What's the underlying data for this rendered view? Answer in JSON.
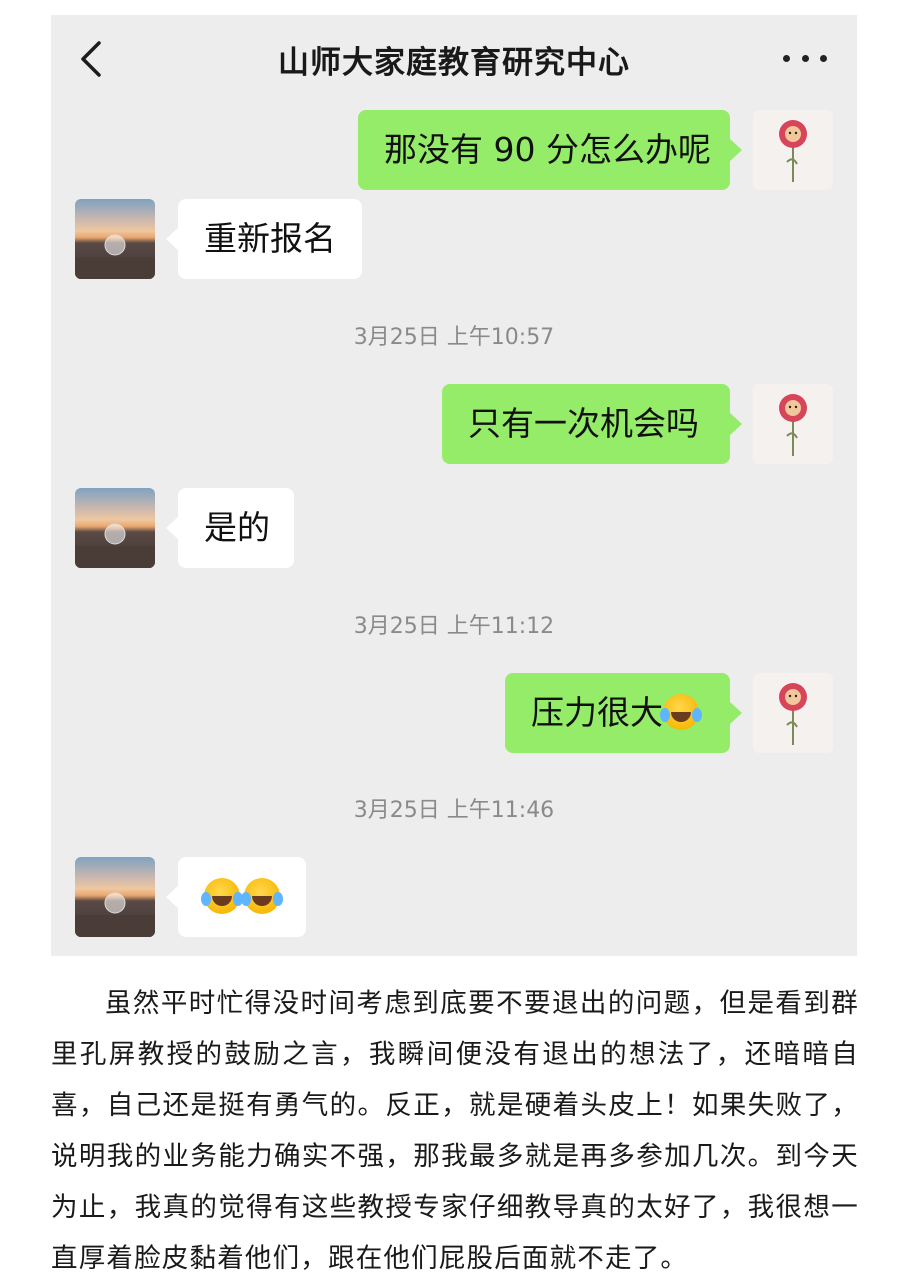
{
  "chat": {
    "title": "山师大家庭教育研究中心",
    "back_icon": "chevron-left-icon",
    "more_icon": "more-dots-icon",
    "messages": [
      {
        "side": "sent",
        "text": "那没有 90 分怎么办呢"
      },
      {
        "side": "recv",
        "text": "重新报名"
      },
      {
        "type": "time",
        "text": "3月25日 上午10:57"
      },
      {
        "side": "sent",
        "text": "只有一次机会吗"
      },
      {
        "side": "recv",
        "text": "是的"
      },
      {
        "type": "time",
        "text": "3月25日 上午11:12"
      },
      {
        "side": "sent",
        "text": "压力很大",
        "emoji": "tears-of-joy-emoji"
      },
      {
        "type": "time",
        "text": "3月25日 上午11:46"
      },
      {
        "side": "recv",
        "text": "",
        "emoji": "rolling-laughing-emoji x2"
      }
    ]
  },
  "article": {
    "paragraph": "虽然平时忙得没时间考虑到底要不要退出的问题，但是看到群里孔屏教授的鼓励之言，我瞬间便没有退出的想法了，还暗暗自喜，自己还是挺有勇气的。反正，就是硬着头皮上！如果失败了，说明我的业务能力确实不强，那我最多就是再多参加几次。到今天为止，我真的觉得有这些教授专家仔细教导真的太好了，我很想一直厚着脸皮黏着他们，跟在他们屁股后面就不走了。"
  },
  "colors": {
    "sent_bubble": "#95ec69",
    "recv_bubble": "#ffffff",
    "chat_bg": "#ededed"
  }
}
